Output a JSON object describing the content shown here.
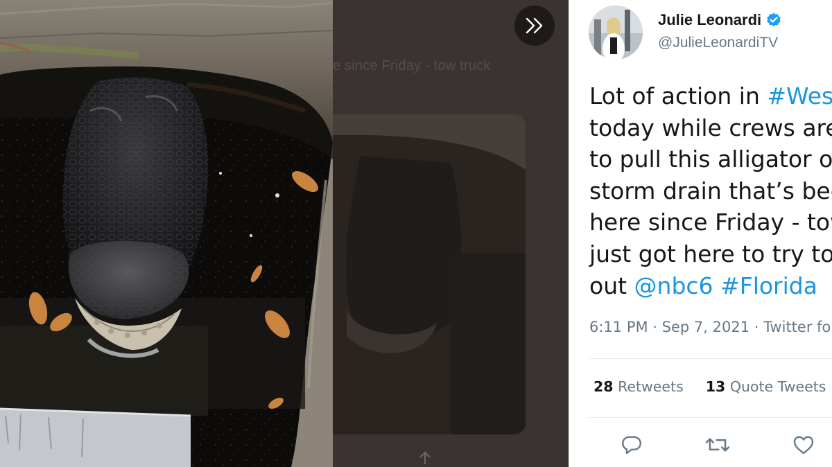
{
  "overlay": {
    "backdrop_text": "e since Friday - tow truck"
  },
  "tweet": {
    "author": {
      "display_name": "Julie Leonardi",
      "handle": "@JulieLeonardiTV"
    },
    "lines": [
      [
        {
          "text": "Lot of action in "
        },
        {
          "text": "#Wes",
          "link": true
        }
      ],
      [
        {
          "text": "today while crews are"
        }
      ],
      [
        {
          "text": "to pull this alligator o"
        }
      ],
      [
        {
          "text": "storm drain that’s bee"
        }
      ],
      [
        {
          "text": "here since Friday - tow"
        }
      ],
      [
        {
          "text": "just got here to try to"
        }
      ],
      [
        {
          "text": "out "
        },
        {
          "text": "@nbc6",
          "link": true
        },
        {
          "text": " "
        },
        {
          "text": "#Florida",
          "link": true
        }
      ]
    ],
    "timestamp": "6:11 PM · Sep 7, 2021 · Twitter fo",
    "retweets": {
      "count": "28",
      "label": "Retweets"
    },
    "quote_tweets": {
      "count": "13",
      "label": "Quote Tweets"
    }
  },
  "colors": {
    "link": "#1b95e0",
    "secondary": "#657786",
    "verified": "#1da1f2",
    "backdrop": "#3b3331"
  }
}
